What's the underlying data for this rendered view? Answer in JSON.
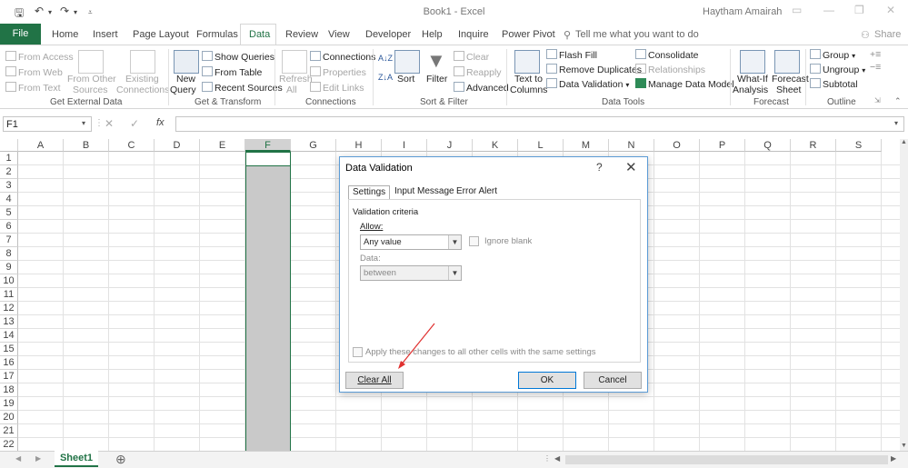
{
  "titlebar": {
    "title": "Book1  -  Excel",
    "user": "Haytham Amairah",
    "save_icon": "save-icon",
    "undo_icon": "undo-icon",
    "redo_icon": "redo-icon"
  },
  "tabs": [
    "File",
    "Home",
    "Insert",
    "Page Layout",
    "Formulas",
    "Data",
    "Review",
    "View",
    "Developer",
    "Help",
    "Inquire",
    "Power Pivot"
  ],
  "tell_me": "Tell me what you want to do",
  "share": "Share",
  "ribbon": {
    "get_external": {
      "from_access": "From Access",
      "from_web": "From Web",
      "from_text": "From Text",
      "from_other": "From Other",
      "from_other2": "Sources",
      "existing": "Existing",
      "existing2": "Connections",
      "label": "Get External Data"
    },
    "get_transform": {
      "new_query": "New",
      "new_query2": "Query",
      "show_queries": "Show Queries",
      "from_table": "From Table",
      "recent_sources": "Recent Sources",
      "label": "Get & Transform"
    },
    "connections": {
      "refresh": "Refresh",
      "refresh2": "All",
      "connections": "Connections",
      "properties": "Properties",
      "edit_links": "Edit Links",
      "label": "Connections"
    },
    "sort_filter": {
      "sort": "Sort",
      "filter": "Filter",
      "clear": "Clear",
      "reapply": "Reapply",
      "advanced": "Advanced",
      "label": "Sort & Filter"
    },
    "data_tools": {
      "text_to": "Text to",
      "columns": "Columns",
      "flash_fill": "Flash Fill",
      "remove_dup": "Remove Duplicates",
      "data_validation": "Data Validation",
      "consolidate": "Consolidate",
      "relationships": "Relationships",
      "manage_model": "Manage Data Model",
      "label": "Data Tools"
    },
    "forecast": {
      "whatif": "What-If",
      "analysis": "Analysis",
      "forecast": "Forecast",
      "sheet": "Sheet",
      "label": "Forecast"
    },
    "outline": {
      "group": "Group",
      "ungroup": "Ungroup",
      "subtotal": "Subtotal",
      "label": "Outline"
    }
  },
  "namebox": "F1",
  "columns": [
    "A",
    "B",
    "C",
    "D",
    "E",
    "F",
    "G",
    "H",
    "I",
    "J",
    "K",
    "L",
    "M",
    "N",
    "O",
    "P",
    "Q",
    "R",
    "S"
  ],
  "rows": [
    "1",
    "2",
    "3",
    "4",
    "5",
    "6",
    "7",
    "8",
    "9",
    "10",
    "11",
    "12",
    "13",
    "14",
    "15",
    "16",
    "17",
    "18",
    "19",
    "20",
    "21",
    "22"
  ],
  "sheet_tab": "Sheet1",
  "dialog": {
    "title": "Data Validation",
    "help": "?",
    "close": "✕",
    "tabs": [
      "Settings",
      "Input Message",
      "Error Alert"
    ],
    "criteria": "Validation criteria",
    "allow_label": "Allow:",
    "allow_value": "Any value",
    "ignore_blank": "Ignore blank",
    "data_label": "Data:",
    "data_value": "between",
    "apply_all": "Apply these changes to all other cells with the same settings",
    "clear_all": "Clear All",
    "ok": "OK",
    "cancel": "Cancel"
  },
  "colors": {
    "excel_green": "#217346",
    "annotation_arrow": "#e0302f"
  }
}
